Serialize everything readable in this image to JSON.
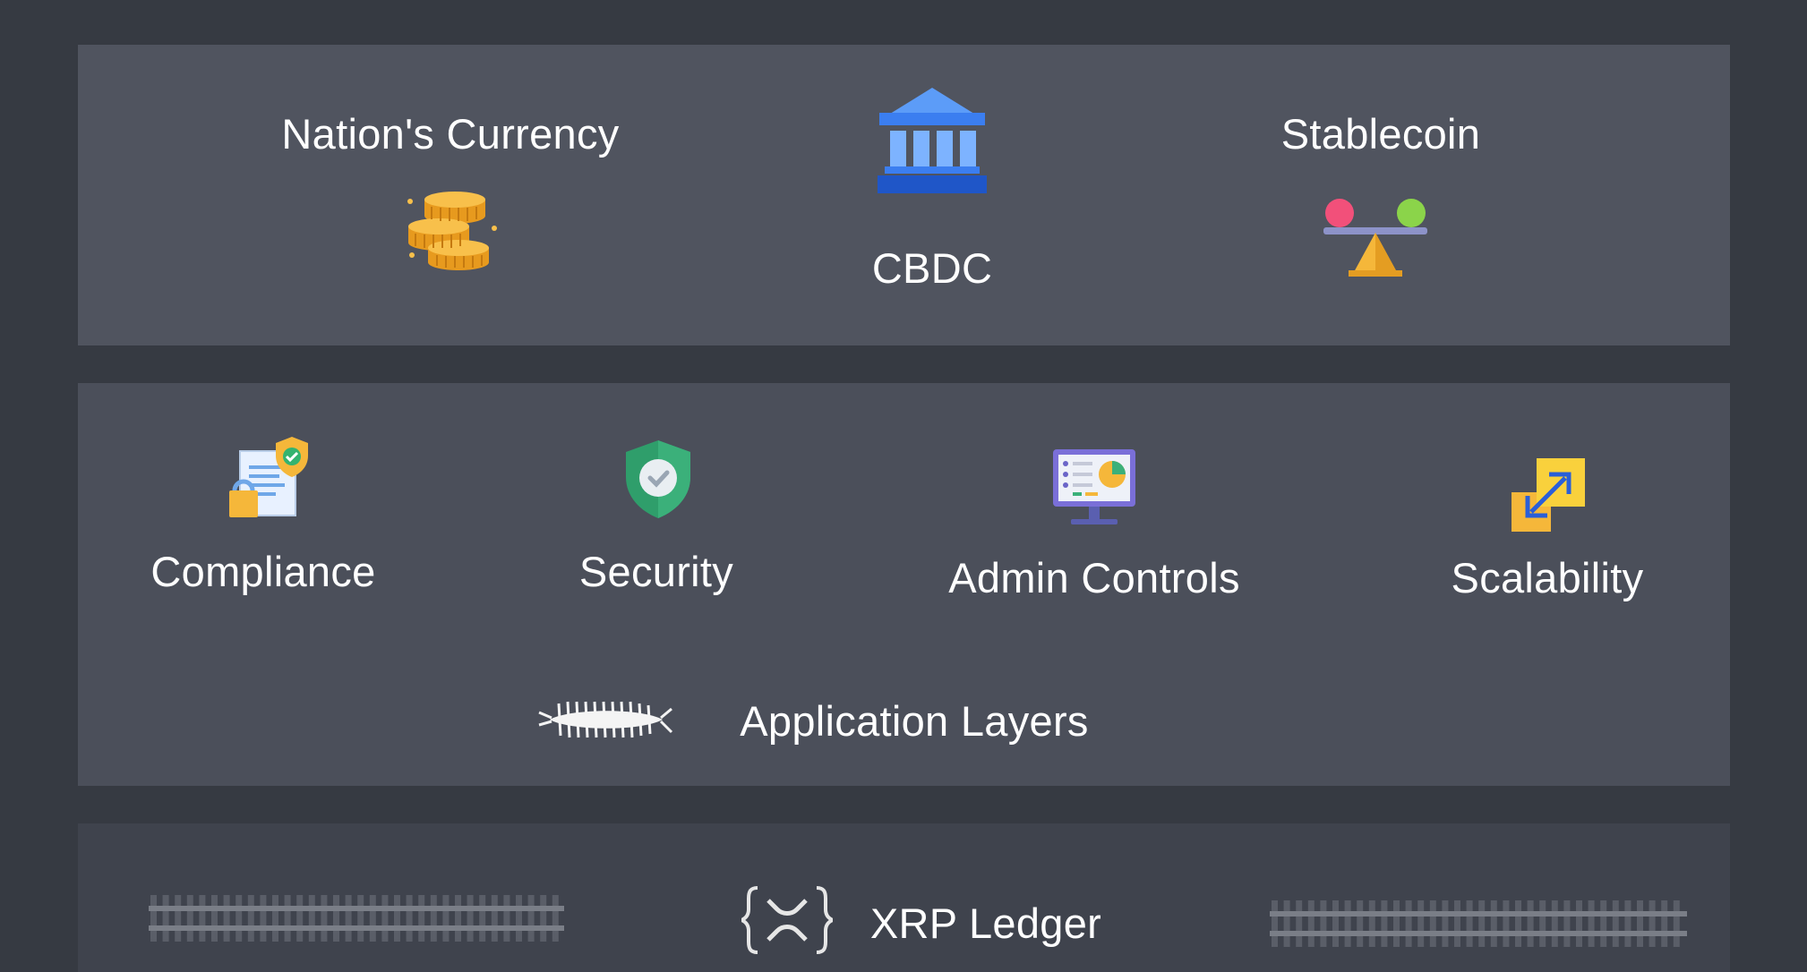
{
  "top": {
    "nation_currency": "Nation's Currency",
    "cbdc": "CBDC",
    "stablecoin": "Stablecoin"
  },
  "features": [
    {
      "label": "Compliance",
      "icon": "compliance-document-icon"
    },
    {
      "label": "Security",
      "icon": "shield-check-icon"
    },
    {
      "label": "Admin Controls",
      "icon": "admin-monitor-icon"
    },
    {
      "label": "Scalability",
      "icon": "scalability-arrows-icon"
    }
  ],
  "layers": {
    "label": "Application Layers",
    "icon": "centipede-icon"
  },
  "ledger": {
    "label": "XRP Ledger",
    "icon": "xrp-logo-icon"
  },
  "colors": {
    "background": "#363a42",
    "panel_top": "#50545f",
    "panel_mid": "#4b4f5a",
    "panel_bottom": "#3f434d",
    "bank_blue": "#3b7ef0",
    "coin_gold": "#f5b73a",
    "shield_green": "#3bb07a"
  }
}
